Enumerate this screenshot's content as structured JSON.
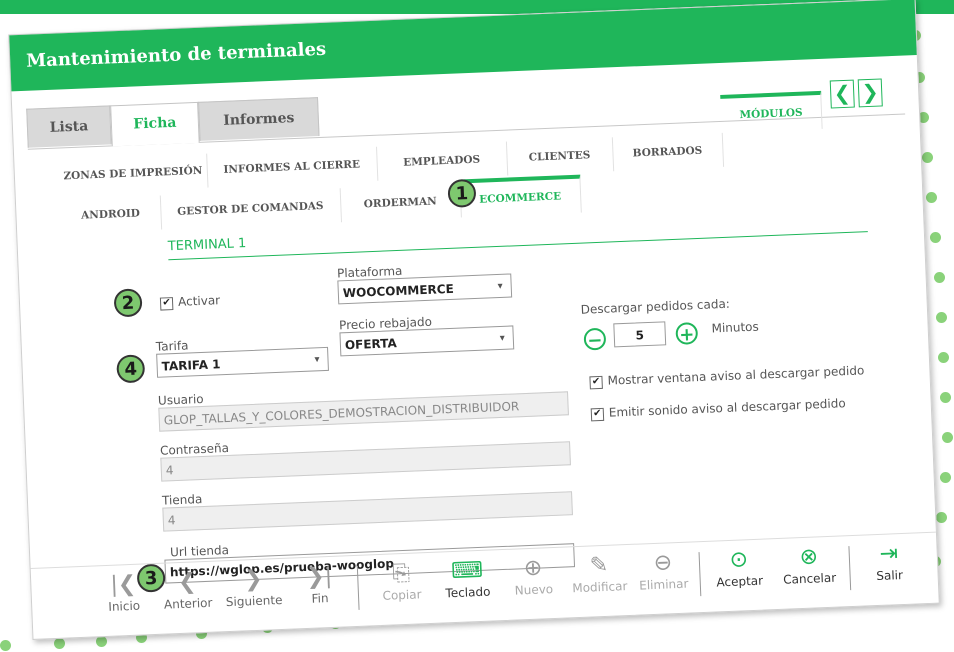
{
  "window": {
    "title": "Mantenimiento de terminales"
  },
  "main_tabs": [
    "Lista",
    "Ficha",
    "Informes"
  ],
  "sub_tabs_row1": [
    "ZONAS DE IMPRESIÓN",
    "INFORMES AL CIERRE",
    "EMPLEADOS",
    "CLIENTES",
    "BORRADOS",
    "MÓDULOS"
  ],
  "sub_tabs_row2": [
    "ANDROID",
    "GESTOR DE COMANDAS",
    "ORDERMAN",
    "ECOMMERCE"
  ],
  "section_title": "TERMINAL 1",
  "form": {
    "activar_label": "Activar",
    "plataforma_label": "Plataforma",
    "plataforma_value": "WOOCOMMERCE",
    "tarifa_label": "Tarifa",
    "tarifa_value": "TARIFA 1",
    "precio_label": "Precio rebajado",
    "precio_value": "OFERTA",
    "descargar_label": "Descargar pedidos cada:",
    "descargar_value": "5",
    "minutos_label": "Minutos",
    "usuario_label": "Usuario",
    "usuario_value": "GLOP_TALLAS_Y_COLORES_DEMOSTRACION_DISTRIBUIDOR",
    "password_label": "Contraseña",
    "password_value": "4",
    "tienda_label": "Tienda",
    "tienda_value": "4",
    "url_label": "Url tienda",
    "url_value": "https://wglop.es/prueba-wooglop",
    "mostrar_label": "Mostrar ventana aviso al descargar pedido",
    "emitir_label": "Emitir sonido aviso al descargar pedido"
  },
  "badges": [
    "1",
    "2",
    "3",
    "4"
  ],
  "toolbar": [
    "Inicio",
    "Anterior",
    "Siguiente",
    "Fin",
    "Copiar",
    "Teclado",
    "Nuevo",
    "Modificar",
    "Eliminar",
    "Aceptar",
    "Cancelar",
    "Salir"
  ],
  "glyphs": {
    "check": "✔",
    "caret": "▾",
    "prev": "❮",
    "next": "❯",
    "minus": "−",
    "plus": "+",
    "first": "|❮",
    "left": "❮",
    "right": "❯",
    "last": "❯|",
    "copy": "⎘",
    "keyboard": "⌨",
    "new": "⊕",
    "edit": "✎",
    "delete": "⊖",
    "accept": "⊙",
    "cancel": "⊗",
    "exit": "⇥"
  },
  "colors": {
    "accent": "#1fb65a",
    "badge": "#7ec86f",
    "dots": "#8ad27a"
  }
}
